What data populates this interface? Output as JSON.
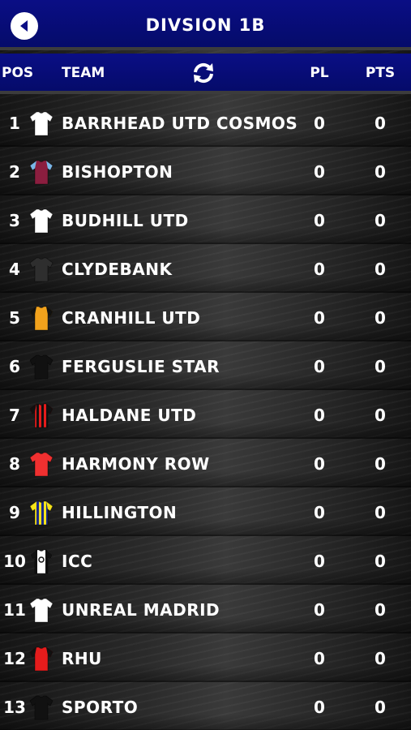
{
  "header": {
    "title": "DIVSION 1B"
  },
  "columns": {
    "pos": "POS",
    "team": "TEAM",
    "pl": "PL",
    "pts": "PTS"
  },
  "icons": {
    "back": "back-arrow-icon",
    "refresh": "refresh-icon"
  },
  "colors": {
    "header_bg": "#0a0e85",
    "row_text": "#ffffff"
  },
  "teams": [
    {
      "pos": "1",
      "name": "BARRHEAD UTD COSMOS",
      "pl": "0",
      "pts": "0",
      "kit": {
        "style": "plain",
        "primary": "#ffffff",
        "secondary": "#dddddd",
        "sleeve": "#ffffff"
      }
    },
    {
      "pos": "2",
      "name": "BISHOPTON",
      "pl": "0",
      "pts": "0",
      "kit": {
        "style": "plain",
        "primary": "#8b1e3f",
        "secondary": "#8b1e3f",
        "sleeve": "#7ab8e8"
      }
    },
    {
      "pos": "3",
      "name": "BUDHILL UTD",
      "pl": "0",
      "pts": "0",
      "kit": {
        "style": "plain",
        "primary": "#ffffff",
        "secondary": "#dddddd",
        "sleeve": "#ffffff"
      }
    },
    {
      "pos": "4",
      "name": "CLYDEBANK",
      "pl": "0",
      "pts": "0",
      "kit": {
        "style": "plain",
        "primary": "#2e2e2e",
        "secondary": "#2e2e2e",
        "sleeve": "#2e2e2e"
      }
    },
    {
      "pos": "5",
      "name": "CRANHILL UTD",
      "pl": "0",
      "pts": "0",
      "kit": {
        "style": "plain",
        "primary": "#f2a21c",
        "secondary": "#f2a21c",
        "sleeve": "#111111"
      }
    },
    {
      "pos": "6",
      "name": "FERGUSLIE STAR",
      "pl": "0",
      "pts": "0",
      "kit": {
        "style": "plain",
        "primary": "#111111",
        "secondary": "#111111",
        "sleeve": "#111111"
      }
    },
    {
      "pos": "7",
      "name": "HALDANE UTD",
      "pl": "0",
      "pts": "0",
      "kit": {
        "style": "stripes",
        "primary": "#e51c1c",
        "secondary": "#111111",
        "sleeve": "#111111"
      }
    },
    {
      "pos": "8",
      "name": "HARMONY ROW",
      "pl": "0",
      "pts": "0",
      "kit": {
        "style": "plain",
        "primary": "#f03030",
        "secondary": "#f03030",
        "sleeve": "#f03030"
      }
    },
    {
      "pos": "9",
      "name": "HILLINGTON",
      "pl": "0",
      "pts": "0",
      "kit": {
        "style": "stripes",
        "primary": "#f4e21a",
        "secondary": "#1a2a8a",
        "sleeve": "#f4e21a"
      }
    },
    {
      "pos": "10",
      "name": "ICC",
      "pl": "0",
      "pts": "0",
      "kit": {
        "style": "band",
        "primary": "#ffffff",
        "secondary": "#111111",
        "sleeve": "#111111"
      }
    },
    {
      "pos": "11",
      "name": "UNREAL MADRID",
      "pl": "0",
      "pts": "0",
      "kit": {
        "style": "plain",
        "primary": "#ffffff",
        "secondary": "#dddddd",
        "sleeve": "#ffffff"
      }
    },
    {
      "pos": "12",
      "name": "RHU",
      "pl": "0",
      "pts": "0",
      "kit": {
        "style": "plain",
        "primary": "#e51c1c",
        "secondary": "#e51c1c",
        "sleeve": "#111111"
      }
    },
    {
      "pos": "13",
      "name": "SPORTO",
      "pl": "0",
      "pts": "0",
      "kit": {
        "style": "plain",
        "primary": "#111111",
        "secondary": "#111111",
        "sleeve": "#111111"
      }
    }
  ]
}
